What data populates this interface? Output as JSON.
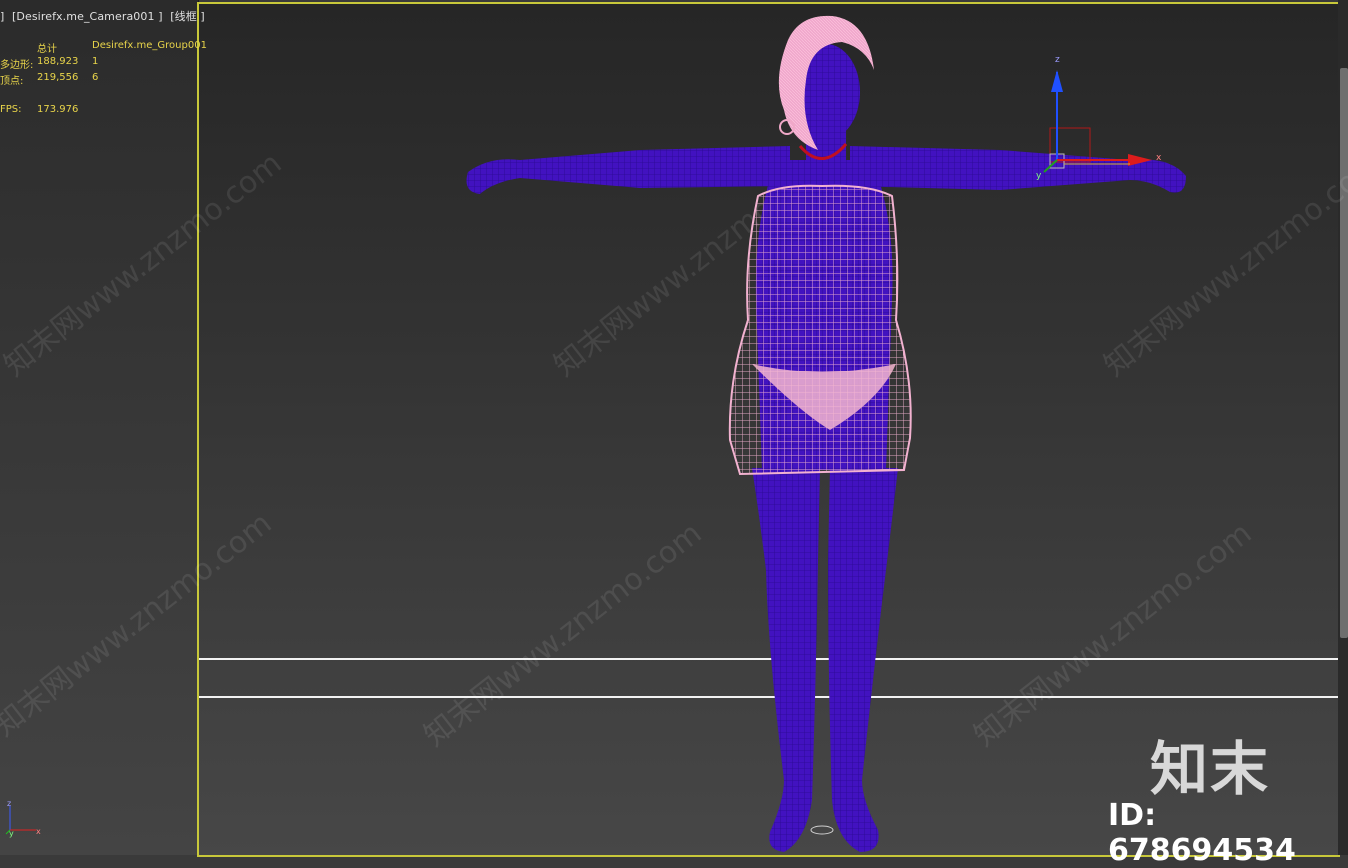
{
  "viewport": {
    "label_parts": [
      "]",
      "[Desirefx.me_Camera001 ]",
      "[线框 ]"
    ]
  },
  "stats": {
    "header": {
      "label": "",
      "total": "总计",
      "selection": "Desirefx.me_Group001"
    },
    "rows": [
      {
        "label": "多边形:",
        "total": "188,923",
        "selection": "1"
      },
      {
        "label": "顶点:",
        "total": "219,556",
        "selection": "6"
      }
    ],
    "fps": {
      "label": "FPS:",
      "value": "173.976"
    }
  },
  "gizmo": {
    "x": "x",
    "y": "y",
    "z": "z"
  },
  "mini_axis": {
    "x": "x",
    "y": "y",
    "z": "z"
  },
  "watermark": {
    "text": "知末网www.znzmo.com"
  },
  "brand": {
    "logo": "知末",
    "id": "ID: 678694534"
  },
  "colors": {
    "body_wire": "#3a12b8",
    "dress_wire": "#f0a8c8",
    "viewport_border": "#c8c83a",
    "stats_text": "#e8d44a"
  }
}
